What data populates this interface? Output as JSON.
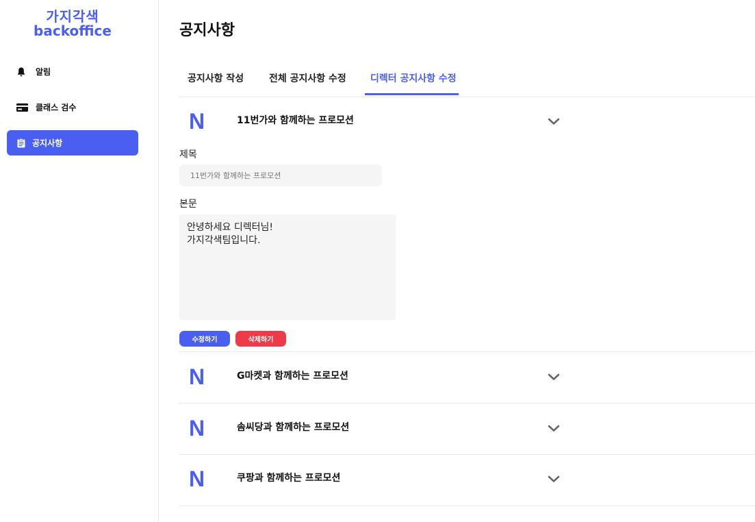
{
  "brand": {
    "line1": "가지각색",
    "line2": "backoffice",
    "accent": "#4a5ef2"
  },
  "sidebar": {
    "items": [
      {
        "label": "알림",
        "icon": "bell-icon",
        "active": false
      },
      {
        "label": "클래스 검수",
        "icon": "card-icon",
        "active": false
      },
      {
        "label": "공지사항",
        "icon": "clipboard-icon",
        "active": true
      }
    ]
  },
  "page": {
    "title": "공지사항"
  },
  "tabs": [
    {
      "label": "공지사항 작성",
      "active": false
    },
    {
      "label": "전체 공지사항 수정",
      "active": false
    },
    {
      "label": "디렉터 공지사항 수정",
      "active": true
    }
  ],
  "notices": [
    {
      "badge": "N",
      "title": "11번가와 함께하는 프로모션",
      "expanded": true
    },
    {
      "badge": "N",
      "title": "G마켓과 함께하는 프로모션",
      "expanded": false
    },
    {
      "badge": "N",
      "title": "솜씨당과 함께하는 프로모션",
      "expanded": false
    },
    {
      "badge": "N",
      "title": "쿠팡과 함께하는 프로모션",
      "expanded": false
    }
  ],
  "editor": {
    "title_label": "제목",
    "title_placeholder": "11번가와 함께하는 프로모션",
    "body_label": "본문",
    "body_value": "안녕하세요 디렉터님!\n가지각색팀입니다.",
    "edit_button": "수정하기",
    "delete_button": "삭제하기",
    "delete_color": "#ee3b4a"
  }
}
